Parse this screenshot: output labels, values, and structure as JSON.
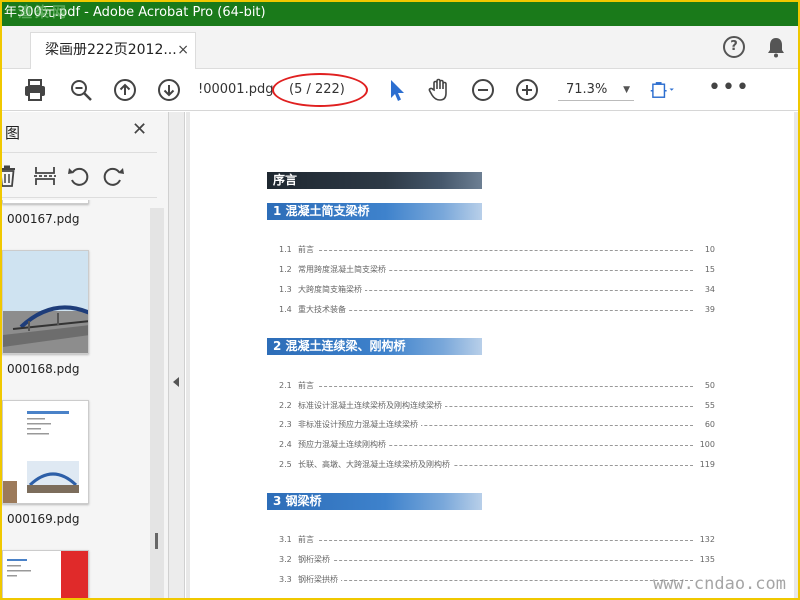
{
  "window": {
    "title": "年300元.pdf - Adobe Acrobat Pro (64-bit)",
    "watermark_text": "渲染网"
  },
  "tab": {
    "label": "梁画册222页2012...",
    "close": "×"
  },
  "tabbar": {
    "help": "?"
  },
  "toolbar": {
    "filename": "!00001.pdg",
    "page_indicator": "(5 / 222)",
    "zoom": "71.3%",
    "more": "•••"
  },
  "sidebar": {
    "title": "图",
    "close": "✕",
    "thumbnails": [
      {
        "label": "000167.pdg"
      },
      {
        "label": "000168.pdg"
      },
      {
        "label": "000169.pdg"
      }
    ]
  },
  "document": {
    "preface_title": "序言",
    "sections": [
      {
        "title": "1  混凝土简支梁桥",
        "entries": [
          {
            "num": "1.1",
            "text": "前言",
            "page": "10"
          },
          {
            "num": "1.2",
            "text": "常用跨度混凝土简支梁桥",
            "page": "15"
          },
          {
            "num": "1.3",
            "text": "大跨度简支箱梁桥",
            "page": "34"
          },
          {
            "num": "1.4",
            "text": "重大技术装备",
            "page": "39"
          }
        ]
      },
      {
        "title": "2  混凝土连续梁、刚构桥",
        "entries": [
          {
            "num": "2.1",
            "text": "前言",
            "page": "50"
          },
          {
            "num": "2.2",
            "text": "标准设计混凝土连续梁桥及刚构连续梁桥",
            "page": "55"
          },
          {
            "num": "2.3",
            "text": "非标准设计预应力混凝土连续梁桥",
            "page": "60"
          },
          {
            "num": "2.4",
            "text": "预应力混凝土连续刚构桥",
            "page": "100"
          },
          {
            "num": "2.5",
            "text": "长联、高墩、大跨混凝土连续梁桥及刚构桥",
            "page": "119"
          }
        ]
      },
      {
        "title": "3  钢梁桥",
        "entries": [
          {
            "num": "3.1",
            "text": "前言",
            "page": "132"
          },
          {
            "num": "3.2",
            "text": "钢桁梁桥",
            "page": "135"
          },
          {
            "num": "3.3",
            "text": "钢桁梁拱桥",
            "page": ""
          }
        ]
      }
    ],
    "watermark": "www.cndao.com"
  }
}
